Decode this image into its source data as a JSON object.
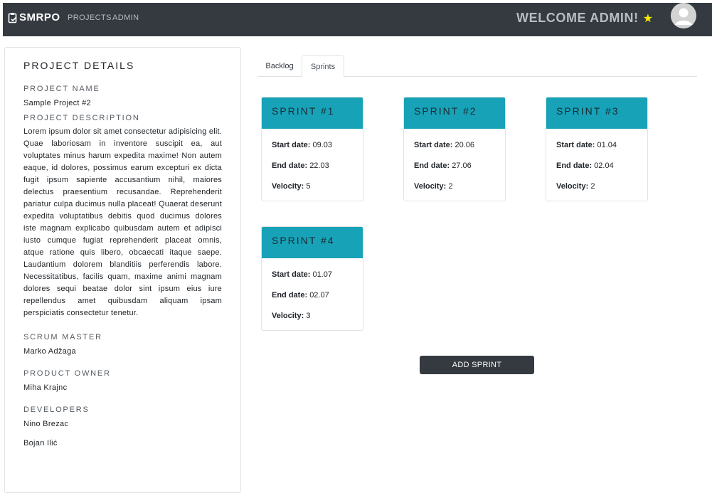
{
  "nav": {
    "brand": "SMRPO",
    "links": [
      "PROJECTS",
      "ADMIN"
    ],
    "welcome": "WELCOME ADMIN!",
    "star_color": "#ffeb00",
    "bg_color": "#343a40"
  },
  "details": {
    "title": "PROJECT DETAILS",
    "name_label": "PROJECT NAME",
    "name": "Sample Project #2",
    "description_label": "PROJECT DESCRIPTION",
    "description": "Lorem ipsum dolor sit amet consectetur adipisicing elit. Quae laboriosam in inventore suscipit ea, aut voluptates minus harum expedita maxime! Non autem eaque, id dolores, possimus earum excepturi ex dicta fugit ipsum sapiente accusantium nihil, maiores delectus praesentium recusandae. Reprehenderit pariatur culpa ducimus nulla placeat! Quaerat deserunt expedita voluptatibus debitis quod ducimus dolores iste magnam explicabo quibusdam autem et adipisci iusto cumque fugiat reprehenderit placeat omnis, atque ratione quis libero, obcaecati itaque saepe. Laudantium dolorem blanditiis perferendis labore. Necessitatibus, facilis quam, maxime animi magnam dolores sequi beatae dolor sint ipsum eius iure repellendus amet quibusdam aliquam ipsam perspiciatis consectetur tenetur.",
    "scrum_master_label": "SCRUM MASTER",
    "scrum_master": "Marko Adžaga",
    "product_owner_label": "PRODUCT OWNER",
    "product_owner": "Miha Krajnc",
    "developers_label": "DEVELOPERS",
    "developers": [
      "Nino Brezac",
      "Bojan Ilić"
    ]
  },
  "tabs": [
    "Backlog",
    "Sprints"
  ],
  "active_tab": "Sprints",
  "sprint_labels": {
    "start": "Start date:",
    "end": "End date:",
    "velocity": "Velocity:"
  },
  "sprints": [
    {
      "title": "SPRINT #1",
      "start": "09.03",
      "end": "22.03",
      "velocity": "5"
    },
    {
      "title": "SPRINT #2",
      "start": "20.06",
      "end": "27.06",
      "velocity": "2"
    },
    {
      "title": "SPRINT #3",
      "start": "01.04",
      "end": "02.04",
      "velocity": "2"
    },
    {
      "title": "SPRINT #4",
      "start": "01.07",
      "end": "02.07",
      "velocity": "3"
    }
  ],
  "sprint_header_color": "#17a2b8",
  "add_button": "ADD SPRINT"
}
